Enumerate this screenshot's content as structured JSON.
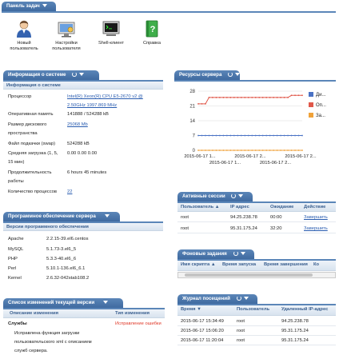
{
  "task_panel": {
    "title": "Панель задач",
    "items": [
      {
        "label_1": "Новый",
        "label_2": "пользователь",
        "icon": "user-icon"
      },
      {
        "label_1": "Настройки",
        "label_2": "пользователя",
        "icon": "monitor-settings-icon"
      },
      {
        "label_1": "Shell-клиент",
        "label_2": "",
        "icon": "terminal-icon"
      },
      {
        "label_1": "Справка",
        "label_2": "",
        "icon": "help-book-icon"
      }
    ]
  },
  "sysinfo": {
    "tab_title": "Информация о системе",
    "sub_title": "Информация о системе",
    "rows": [
      {
        "label": "Процессор",
        "value": "Intel(R) Xeon(R) CPU E5-2670 v2 @",
        "value2": "2.50GHz 1997.869 MHz"
      },
      {
        "label": "Оперативная память",
        "value": "141888 / 524288 kB"
      },
      {
        "label": "Размер дискового",
        "label2": "пространства",
        "value": "25068 Mb"
      },
      {
        "label": "Файл подкачки (swap)",
        "value": "524288 kB"
      },
      {
        "label": "Средняя загрузка (1, 5,",
        "label2": "15 мин)",
        "value": "0.00 0.00 0.00"
      },
      {
        "label": "Продолжительность",
        "label2": "работы",
        "value": "6 hours 45 minutes"
      },
      {
        "label": "Количество процессов",
        "value": "22"
      }
    ]
  },
  "software": {
    "tab_title": "Программное обеспечение сервера",
    "sub_title": "Версии программного обеспечения",
    "rows": [
      {
        "name": "Apache",
        "version": "2.2.15-39.el6.centos"
      },
      {
        "name": "MySQL",
        "version": "5.1.73-3.el6_5"
      },
      {
        "name": "PHP",
        "version": "5.3.3-40.el6_6"
      },
      {
        "name": "Perl",
        "version": "5.10.1-136.el6_6.1"
      },
      {
        "name": "Kernel",
        "version": "2.6.32-042stab108.2"
      }
    ]
  },
  "changelog": {
    "tab_title": "Список изменений текущей версии",
    "col_desc": "Описание изменения",
    "col_type": "Тип изменения",
    "group": "Службы",
    "entry_lines": [
      "Исправлена функция загрузки",
      "пользовательского xml с описанием",
      "служб сервера."
    ],
    "entry_type": "Исправление ошибки",
    "colors": {
      "error_type": "#e03a2a"
    }
  },
  "resources": {
    "tab_title": "Ресурсы сервера",
    "legend": [
      "Ди...",
      "Оп...",
      "За..."
    ]
  },
  "chart_data": {
    "type": "line",
    "x": [
      "2015-06-17 1...",
      "2015-06-17 1...",
      "2015-06-17 2...",
      "2015-06-17 2...",
      "2015-06-17 2..."
    ],
    "ylim": [
      0,
      28
    ],
    "yticks": [
      0,
      7,
      14,
      21,
      28
    ],
    "series": [
      {
        "name": "Ди...",
        "color": "#4a72c4",
        "values": [
          7,
          7,
          7,
          7,
          7,
          7,
          7,
          7,
          7,
          7,
          7,
          7,
          7,
          7,
          7,
          7,
          7,
          7,
          7,
          7,
          7,
          7,
          7,
          7,
          7,
          7,
          7,
          7,
          7,
          7
        ]
      },
      {
        "name": "Оп...",
        "color": "#e0584a",
        "values": [
          22,
          22,
          22,
          25,
          25,
          25,
          25,
          25,
          25,
          25,
          25,
          25,
          25,
          25,
          25,
          25,
          25,
          25,
          25,
          25,
          25,
          25,
          25,
          25,
          25,
          25,
          26,
          26,
          26,
          26
        ]
      },
      {
        "name": "За...",
        "color": "#f0a23a",
        "values": [
          0,
          0,
          0,
          0,
          0,
          0,
          0,
          0,
          0,
          0,
          0,
          0,
          0,
          0,
          0,
          0,
          0,
          0,
          0,
          0,
          0,
          0,
          0,
          0,
          0,
          0,
          0,
          0,
          0,
          0
        ]
      }
    ]
  },
  "sessions": {
    "tab_title": "Активные сессии",
    "columns": [
      "Пользователь ▲",
      "IP адрес",
      "Ожидание",
      "Действие"
    ],
    "rows": [
      {
        "user": "root",
        "ip": "94.25.238.78",
        "wait": "00:00",
        "action": "Завершить"
      },
      {
        "user": "root",
        "ip": "95.31.175.24",
        "wait": "32:20",
        "action": "Завершить"
      }
    ]
  },
  "background": {
    "tab_title": "Фоновые задания",
    "columns": [
      "Имя скрипта ▲",
      "Время запуска",
      "Время завершения",
      "Ко"
    ]
  },
  "visits": {
    "tab_title": "Журнал посещений",
    "columns": [
      "Время ▼",
      "Пользователь",
      "Удаленный IP-адрес"
    ],
    "rows": [
      {
        "time": "2015-06-17 15:34:49",
        "user": "root",
        "ip": "94.25.238.78"
      },
      {
        "time": "2015-06-17 15:06:20",
        "user": "root",
        "ip": "95.31.175.24"
      },
      {
        "time": "2015-06-17 11:20:04",
        "user": "root",
        "ip": "95.31.175.24"
      }
    ]
  }
}
